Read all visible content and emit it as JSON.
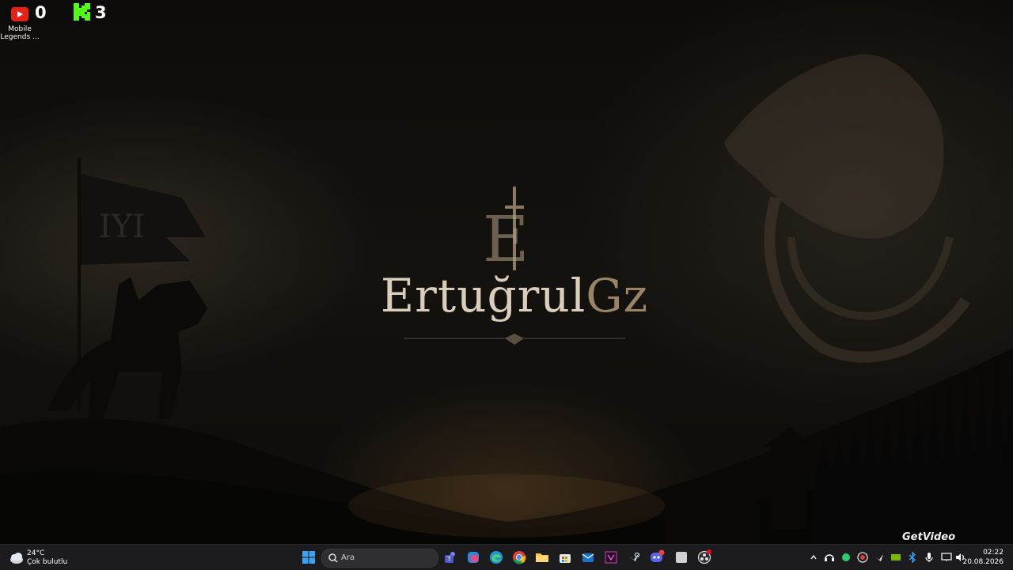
{
  "desktop": {
    "logo_text_main": "Ertuğrul",
    "logo_text_accent": "Gz",
    "icons": [
      {
        "label": "Mobile Legends ...",
        "icon": "youtube-icon"
      }
    ],
    "counters": [
      {
        "icon": "youtube-icon",
        "value": "0"
      },
      {
        "icon": "kick-icon",
        "value": "3"
      }
    ],
    "watermark": "GetVideo"
  },
  "taskbar": {
    "weather": {
      "temp": "24°C",
      "condition": "Çok bulutlu"
    },
    "search_placeholder": "Ara",
    "pinned": [
      "windows-start-icon",
      "teams-icon",
      "copilot-icon",
      "edge-icon",
      "chrome-icon",
      "file-explorer-icon",
      "microsoft-store-icon",
      "mail-icon",
      "visual-studio-icon",
      "steam-icon",
      "discord-icon",
      "app-icon",
      "obs-icon"
    ],
    "tray": {
      "clock_time": "02:22",
      "clock_date": "20.08.2026"
    }
  },
  "colors": {
    "taskbar_bg": "#1c1c1e",
    "logo_text": "#d9cdbb",
    "logo_accent": "#9b8466"
  }
}
